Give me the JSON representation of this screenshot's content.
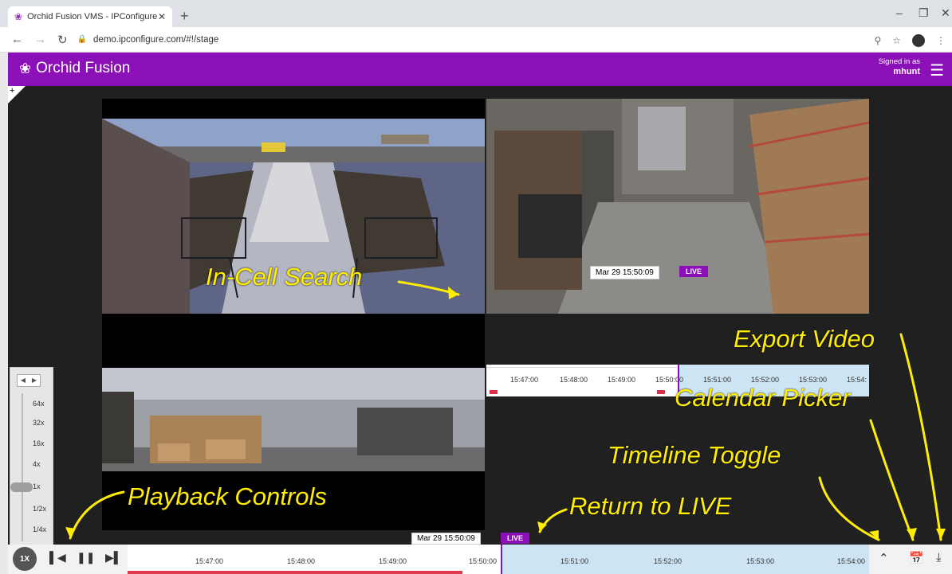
{
  "browser": {
    "tab_title": "Orchid Fusion VMS - IPConfigure",
    "url": "demo.ipconfigure.com/#!/stage"
  },
  "header": {
    "logo_text": "Orchid Fusion",
    "signed_in_label": "Signed in as",
    "username": "mhunt"
  },
  "cell_timeline": {
    "current_time": "Mar 29 15:50:09",
    "live_label": "LIVE",
    "ticks": [
      "15:47:00",
      "15:48:00",
      "15:49:00",
      "15:50:00",
      "15:51:00",
      "15:52:00",
      "15:53:00",
      "15:54:"
    ]
  },
  "playback": {
    "speeds": [
      "64x",
      "32x",
      "16x",
      "4x",
      "1x",
      "1/2x",
      "1/4x"
    ],
    "rate_button": "1X"
  },
  "bottom_timeline": {
    "current_time": "Mar 29 15:50:09",
    "live_label": "LIVE",
    "ticks": [
      "15:47:00",
      "15:48:00",
      "15:49:00",
      "15:50:00",
      "15:51:00",
      "15:52:00",
      "15:53:00",
      "15:54:00"
    ]
  },
  "annotations": {
    "in_cell_search": "In-Cell Search",
    "export_video": "Export Video",
    "calendar_picker": "Calendar Picker",
    "timeline_toggle": "Timeline Toggle",
    "playback_controls": "Playback Controls",
    "return_to_live": "Return to LIVE"
  },
  "colors": {
    "brand_purple": "#8b10b8",
    "annotation_yellow": "#ffee00",
    "live_region": "#cce4f3"
  },
  "icons": [
    "orchid-logo-icon",
    "menu-icon",
    "skip-back-icon",
    "pause-icon",
    "skip-forward-icon",
    "chevron-up-icon",
    "calendar-icon",
    "download-icon"
  ]
}
